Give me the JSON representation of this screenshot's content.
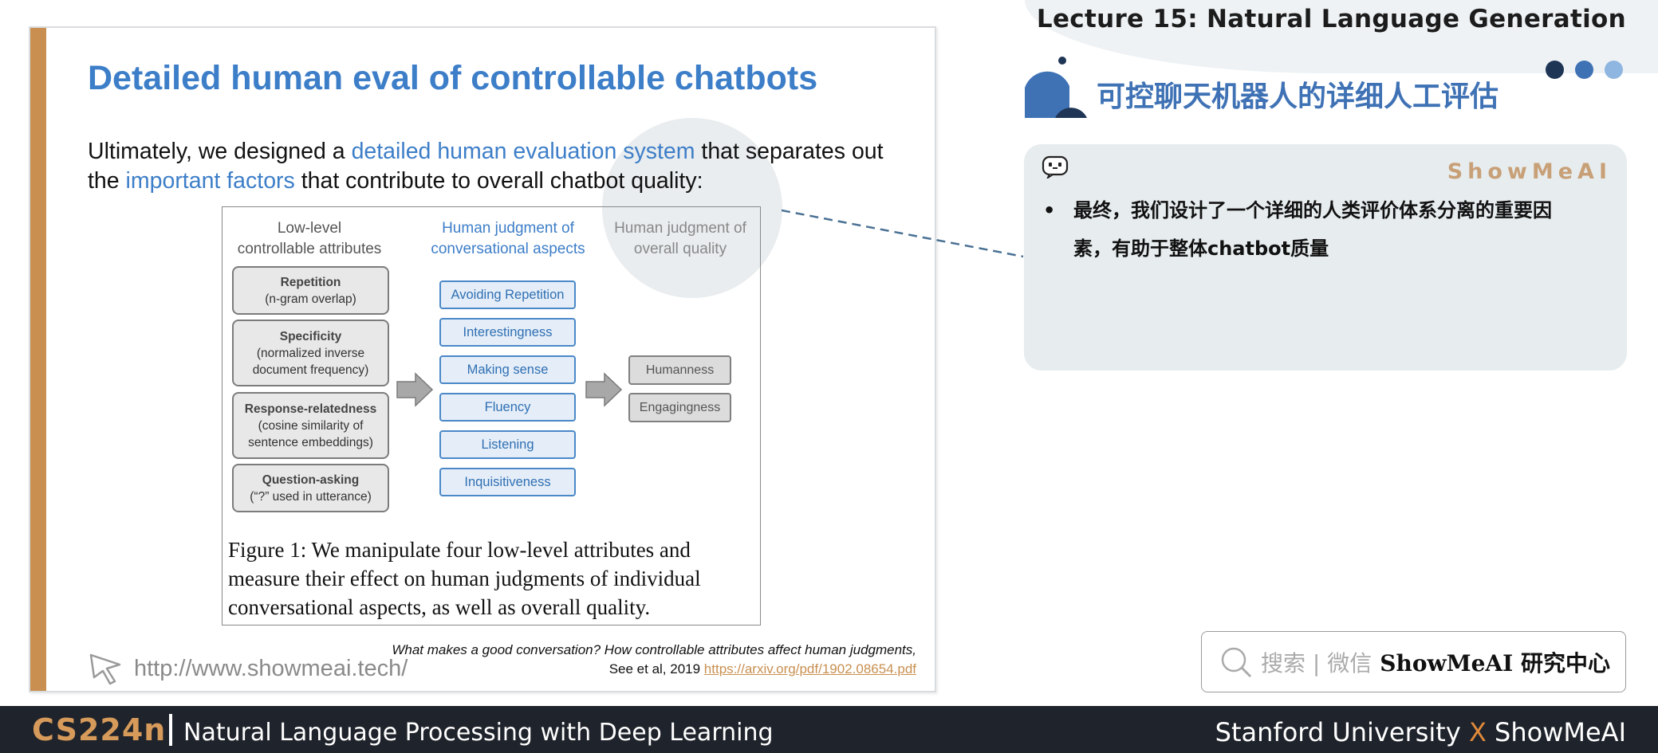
{
  "header": {
    "lecture_title": "Lecture 15: Natural Language Generation",
    "cn_title": "可控聊天机器人的详细人工评估"
  },
  "slide": {
    "title": "Detailed human eval of controllable chatbots",
    "body": {
      "part1": "Ultimately, we designed a ",
      "highlight1": "detailed human evaluation system",
      "part2": " that separates out the ",
      "highlight2": "important factors",
      "part3": " that contribute to overall chatbot quality:"
    },
    "figure": {
      "col_headers": {
        "low_line1": "Low-level",
        "low_line2": "controllable attributes",
        "mid_line1": "Human judgment of",
        "mid_line2": "conversational aspects",
        "right_line1": "Human judgment of",
        "right_line2": "overall quality"
      },
      "attributes": [
        {
          "name": "Repetition",
          "desc1": "(n-gram overlap)",
          "desc2": ""
        },
        {
          "name": "Specificity",
          "desc1": "(normalized inverse",
          "desc2": "document frequency)"
        },
        {
          "name": "Response-relatedness",
          "desc1": "(cosine similarity of",
          "desc2": "sentence embeddings)"
        },
        {
          "name": "Question-asking",
          "desc1": "(“?” used in utterance)",
          "desc2": ""
        }
      ],
      "aspects": [
        "Avoiding Repetition",
        "Interestingness",
        "Making sense",
        "Fluency",
        "Listening",
        "Inquisitiveness"
      ],
      "overall": [
        "Humanness",
        "Engagingness"
      ],
      "caption": "Figure 1: We manipulate four low-level attributes and measure their effect on human judgments of individual conversational aspects, as well as overall quality."
    },
    "citation": {
      "line1": "What makes a good conversation? How controllable attributes affect human judgments,",
      "line2_prefix": "See et al, 2019 ",
      "link": "https://arxiv.org/pdf/1902.08654.pdf"
    },
    "site_url": "http://www.showmeai.tech/"
  },
  "note": {
    "brand": "ShowMeAI",
    "bullet": "•",
    "line1": "最终，我们设计了一个详细的人类评价体系分离的重要因",
    "line2": "素，有助于整体chatbot质量"
  },
  "search": {
    "hint": "搜索 | 微信",
    "brand": "ShowMeAI 研究中心"
  },
  "footer": {
    "course_code": "CS224n",
    "course_name": "Natural Language Processing with Deep Learning",
    "right_part1": "Stanford University ",
    "right_x": "X",
    "right_part2": " ShowMeAI"
  },
  "colors": {
    "accent_blue": "#3d7ec8",
    "accent_orange": "#c88f50",
    "footer_bg": "#1f232b",
    "dot1": "#1f3556",
    "dot2": "#3f72b5",
    "dot3": "#8fb6e0"
  },
  "icons": [
    "arrow-right-icon",
    "cursor-pointer-icon",
    "robot-face-icon",
    "search-icon"
  ]
}
